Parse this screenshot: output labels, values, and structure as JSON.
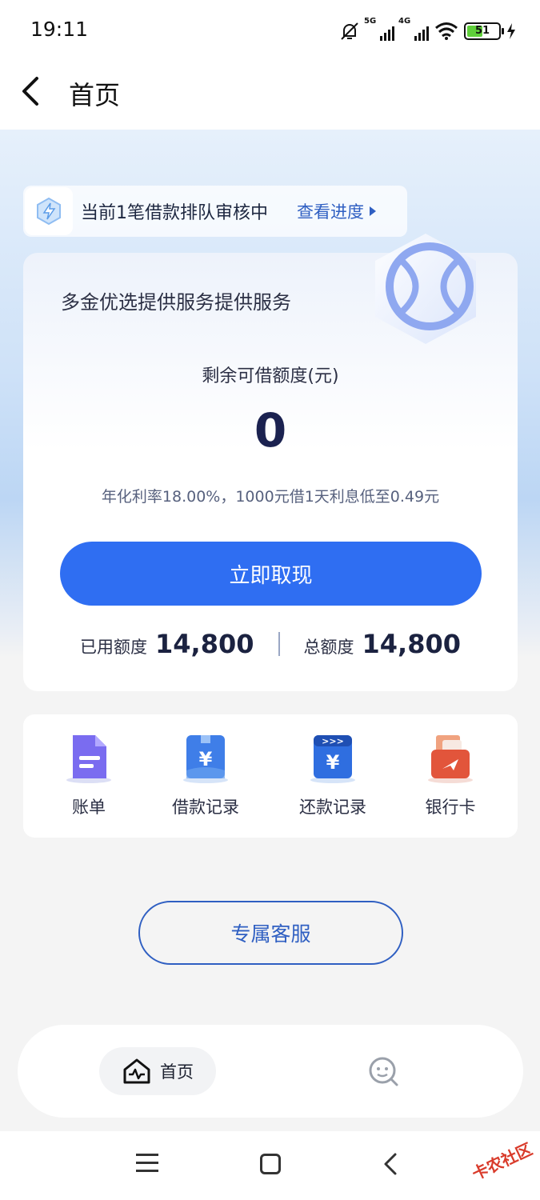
{
  "status_bar": {
    "time": "19:11",
    "battery": "51",
    "net1": "5G",
    "net2": "4G"
  },
  "nav": {
    "title": "首页"
  },
  "notice": {
    "text": "当前1笔借款排队审核中",
    "link": "查看进度"
  },
  "card": {
    "provider": "多金优选提供服务提供服务",
    "available_label": "剩余可借额度(元)",
    "available_amount": "0",
    "rate_text": "年化利率18.00%，1000元借1天利息低至0.49元",
    "withdraw_button": "立即取现",
    "used_label": "已用额度",
    "used_value": "14,800",
    "total_label": "总额度",
    "total_value": "14,800"
  },
  "actions": [
    {
      "label": "账单",
      "icon": "bill-icon"
    },
    {
      "label": "借款记录",
      "icon": "loan-record-icon"
    },
    {
      "label": "还款记录",
      "icon": "repayment-record-icon"
    },
    {
      "label": "银行卡",
      "icon": "bank-card-icon"
    }
  ],
  "service_button": "专属客服",
  "tabbar": {
    "home": "首页"
  },
  "watermark": "卡农社区",
  "colors": {
    "primary": "#2f6ef2",
    "link": "#2f5fc2",
    "amount": "#1b2250"
  }
}
